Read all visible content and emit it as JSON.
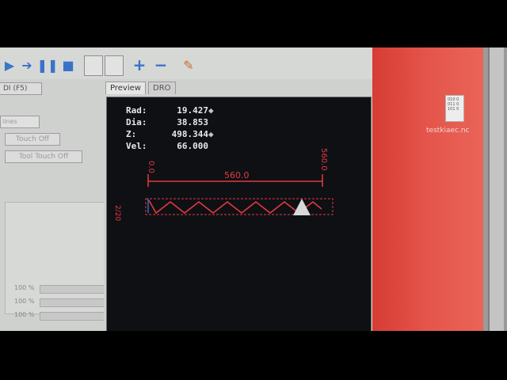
{
  "left_panel": {
    "tab_label": "DI (F5)",
    "mode_select": "lines",
    "touch_off_label": "Touch Off",
    "tool_touch_off_label": "Tool Touch Off",
    "overrides": [
      "100 %",
      "100 %",
      "100 %"
    ]
  },
  "tabs": [
    {
      "label": "Preview"
    },
    {
      "label": "DRO"
    }
  ],
  "dro": {
    "rad_label": "Rad:",
    "rad_value": "19.427",
    "dia_label": "Dia:",
    "dia_value": "38.853",
    "z_label": "Z:",
    "z_value": "498.344",
    "vel_label": "Vel:",
    "vel_value": "66.000"
  },
  "preview": {
    "dim_start": "0.0",
    "dim_end": "560.0",
    "dim_length": "560.0",
    "tool_origin_label": "2/20"
  },
  "desktop": {
    "file_label": "testkiaec.nc"
  },
  "colors": {
    "preview_bg": "#0e1014",
    "toolpath": "#e23a40",
    "dro_text": "#e8e8e8",
    "desktop": "#e0493f"
  }
}
